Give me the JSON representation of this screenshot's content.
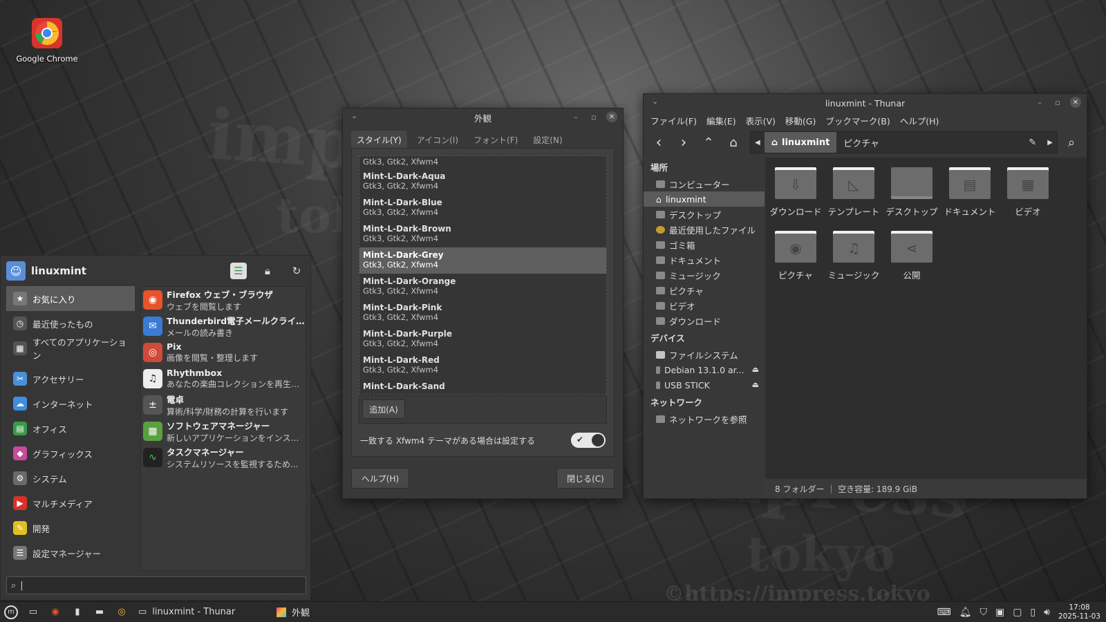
{
  "desktop": {
    "icons": [
      {
        "label": "Google Chrome",
        "icon": "chrome-icon"
      }
    ]
  },
  "appearance": {
    "title": "外観",
    "tabs": [
      "スタイル(Y)",
      "アイコン(I)",
      "フォント(F)",
      "設定(N)"
    ],
    "themes": [
      {
        "name": "",
        "sub": "Gtk3, Gtk2, Xfwm4"
      },
      {
        "name": "Mint-L-Dark-Aqua",
        "sub": "Gtk3, Gtk2, Xfwm4"
      },
      {
        "name": "Mint-L-Dark-Blue",
        "sub": "Gtk3, Gtk2, Xfwm4"
      },
      {
        "name": "Mint-L-Dark-Brown",
        "sub": "Gtk3, Gtk2, Xfwm4"
      },
      {
        "name": "Mint-L-Dark-Grey",
        "sub": "Gtk3, Gtk2, Xfwm4",
        "selected": true
      },
      {
        "name": "Mint-L-Dark-Orange",
        "sub": "Gtk3, Gtk2, Xfwm4"
      },
      {
        "name": "Mint-L-Dark-Pink",
        "sub": "Gtk3, Gtk2, Xfwm4"
      },
      {
        "name": "Mint-L-Dark-Purple",
        "sub": "Gtk3, Gtk2, Xfwm4"
      },
      {
        "name": "Mint-L-Dark-Red",
        "sub": "Gtk3, Gtk2, Xfwm4"
      },
      {
        "name": "Mint-L-Dark-Sand",
        "sub": ""
      }
    ],
    "add_button": "追加(A)",
    "toggle_label": "一致する Xfwm4 テーマがある場合は設定する",
    "toggle_on": true,
    "help_button": "ヘルプ(H)",
    "close_button": "閉じる(C)"
  },
  "thunar": {
    "title": "linuxmint - Thunar",
    "menu": [
      "ファイル(F)",
      "編集(E)",
      "表示(V)",
      "移動(G)",
      "ブックマーク(B)",
      "ヘルプ(H)"
    ],
    "path": [
      "linuxmint",
      "ピクチャ"
    ],
    "sidebar": {
      "places_header": "場所",
      "places": [
        "コンピューター",
        "linuxmint",
        "デスクトップ",
        "最近使用したファイル",
        "ゴミ箱",
        "ドキュメント",
        "ミュージック",
        "ピクチャ",
        "ビデオ",
        "ダウンロード"
      ],
      "devices_header": "デバイス",
      "devices": [
        "ファイルシステム",
        "Debian 13.1.0 ar...",
        "USB STICK"
      ],
      "network_header": "ネットワーク",
      "network": [
        "ネットワークを参照"
      ]
    },
    "files": [
      {
        "label": "ダウンロード",
        "glyph": "⇩"
      },
      {
        "label": "テンプレート",
        "glyph": "◺"
      },
      {
        "label": "デスクトップ",
        "glyph": ""
      },
      {
        "label": "ドキュメント",
        "glyph": "▤"
      },
      {
        "label": "ビデオ",
        "glyph": "▦"
      },
      {
        "label": "ピクチャ",
        "glyph": "◉"
      },
      {
        "label": "ミュージック",
        "glyph": "♫"
      },
      {
        "label": "公開",
        "glyph": "⋖"
      }
    ],
    "status": "8 フォルダー ｜ 空き容量: 189.9 GiB"
  },
  "whisker": {
    "username": "linuxmint",
    "categories": [
      {
        "label": "お気に入り",
        "color": "#777777",
        "glyph": "★"
      },
      {
        "label": "最近使ったもの",
        "color": "#555555",
        "glyph": "◷"
      },
      {
        "label": "すべてのアプリケーション",
        "color": "#555555",
        "glyph": "▦"
      },
      {
        "label": "アクセサリー",
        "color": "#4a90d9",
        "glyph": "✂"
      },
      {
        "label": "インターネット",
        "color": "#3d8fe0",
        "glyph": "☁"
      },
      {
        "label": "オフィス",
        "color": "#3a9a4a",
        "glyph": "▤"
      },
      {
        "label": "グラフィックス",
        "color": "#c84a9a",
        "glyph": "◆"
      },
      {
        "label": "システム",
        "color": "#6a6a6a",
        "glyph": "⚙"
      },
      {
        "label": "マルチメディア",
        "color": "#d9302a",
        "glyph": "▶"
      },
      {
        "label": "開発",
        "color": "#e0c020",
        "glyph": "✎"
      },
      {
        "label": "設定マネージャー",
        "color": "#777777",
        "glyph": "☰"
      }
    ],
    "apps": [
      {
        "name": "Firefox ウェブ・ブラウザ",
        "desc": "ウェブを閲覧します",
        "color": "#e8532a",
        "glyph": "◉"
      },
      {
        "name": "Thunderbird電子メールクライア...",
        "desc": "メールの読み書き",
        "color": "#3a7bd5",
        "glyph": "✉"
      },
      {
        "name": "Pix",
        "desc": "画像を閲覧・整理します",
        "color": "#d04a3a",
        "glyph": "◎"
      },
      {
        "name": "Rhythmbox",
        "desc": "あなたの楽曲コレクションを再生、...",
        "color": "#eeeeee",
        "glyph": "♫"
      },
      {
        "name": "電卓",
        "desc": "算術/科学/財務の計算を行います",
        "color": "#555555",
        "glyph": "±"
      },
      {
        "name": "ソフトウェアマネージャー",
        "desc": "新しいアプリケーションをインスト...",
        "color": "#5aa040",
        "glyph": "▦"
      },
      {
        "name": "タスクマネージャー",
        "desc": "システムリソースを監視するため...",
        "color": "#222222",
        "glyph": "∿"
      }
    ]
  },
  "panel": {
    "tasks": [
      {
        "label": "linuxmint - Thunar"
      },
      {
        "label": "外観"
      }
    ],
    "clock_time": "17:08",
    "clock_date": "2025-11-03"
  }
}
